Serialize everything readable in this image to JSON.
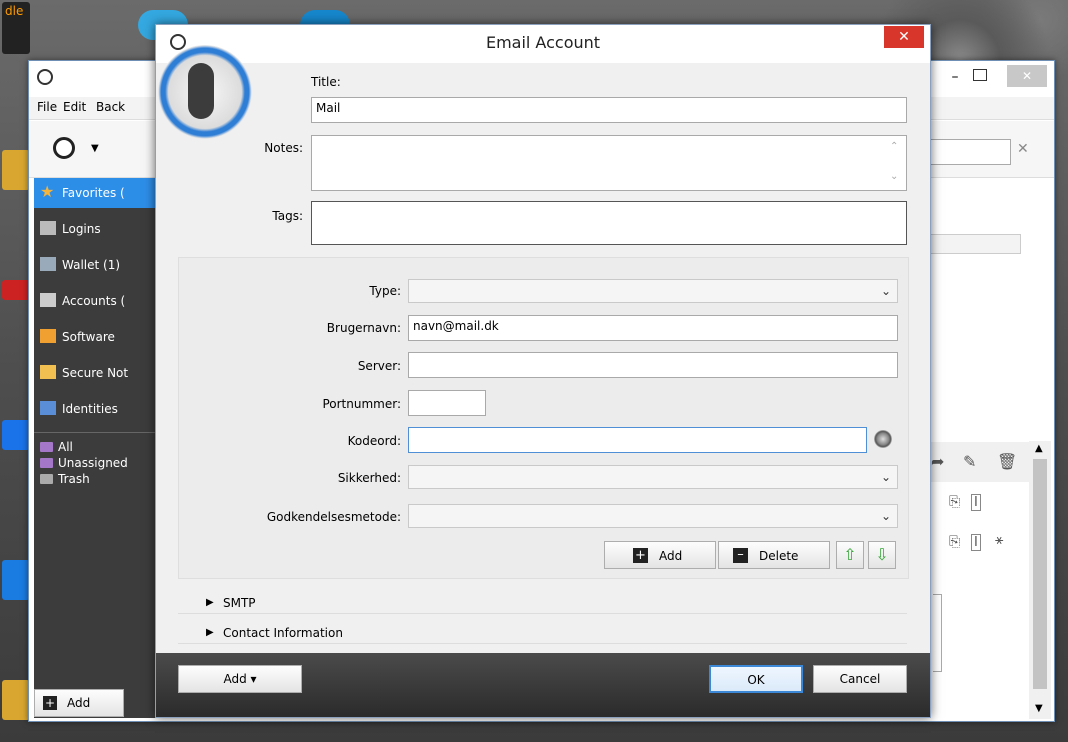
{
  "desktop": {
    "icon_label": "dle"
  },
  "main_window": {
    "menu": [
      "File",
      "Edit",
      "Back"
    ],
    "sidebar": [
      {
        "label": "Favorites (",
        "icon": "star-icon",
        "selected": true
      },
      {
        "label": "Logins",
        "icon": "key-icon"
      },
      {
        "label": "Wallet (1)",
        "icon": "wallet-icon"
      },
      {
        "label": "Accounts (",
        "icon": "accounts-icon"
      },
      {
        "label": "Software",
        "icon": "software-icon"
      },
      {
        "label": "Secure Not",
        "icon": "note-icon"
      },
      {
        "label": "Identities",
        "icon": "identity-icon"
      }
    ],
    "vaults": [
      "All",
      "Unassigned",
      "Trash"
    ],
    "add_label": "Add"
  },
  "dialog": {
    "title": "Email Account",
    "close": "✕",
    "title_label": "Title:",
    "title_value": "Mail",
    "notes_label": "Notes:",
    "notes_value": "",
    "tags_label": "Tags:",
    "tags_value": "",
    "fields": {
      "type_label": "Type:",
      "type_value": "",
      "username_label": "Brugernavn:",
      "username_value": "navn@mail.dk",
      "server_label": "Server:",
      "server_value": "",
      "port_label": "Portnummer:",
      "port_value": "",
      "password_label": "Kodeord:",
      "password_value": "",
      "security_label": "Sikkerhed:",
      "security_value": "",
      "auth_label": "Godkendelsesmetode:",
      "auth_value": ""
    },
    "add_button": "Add",
    "delete_button": "Delete",
    "sections": [
      "SMTP",
      "Contact Information"
    ],
    "footer": {
      "add_menu": "Add ▾",
      "ok": "OK",
      "cancel": "Cancel"
    }
  },
  "colors": {
    "selection": "#2d8ee8",
    "close": "#d9362b",
    "up_arrow": "#3aa63a"
  }
}
